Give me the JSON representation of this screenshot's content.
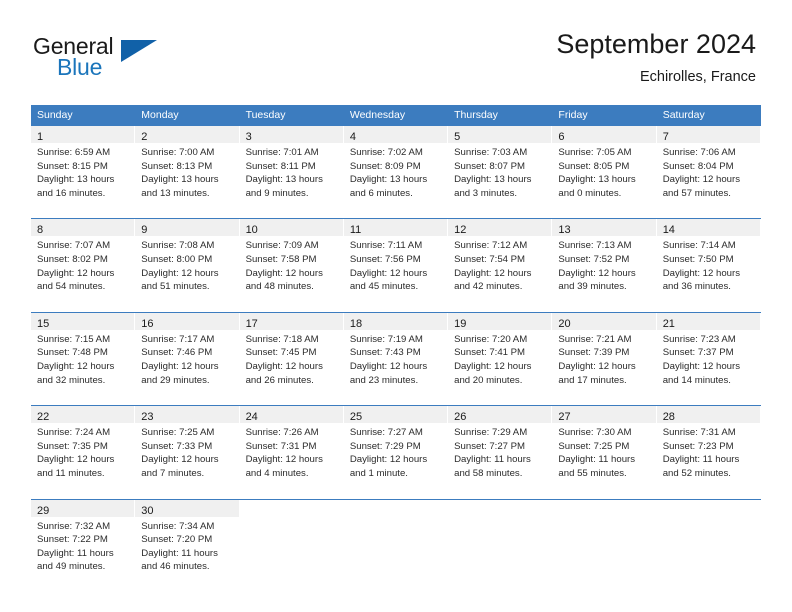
{
  "brand": {
    "word_one": "General",
    "word_two": "Blue",
    "flag_icon": "blue-triangle-flag-icon"
  },
  "header": {
    "title": "September 2024",
    "subtitle": "Echirolles, France"
  },
  "colors": {
    "header_blue": "#3c7cbf",
    "brand_blue": "#1b75bb",
    "flag_blue": "#1161a8",
    "day_band_gray": "#f0f0f0",
    "text": "#1a1a1a"
  },
  "weekdays": [
    "Sunday",
    "Monday",
    "Tuesday",
    "Wednesday",
    "Thursday",
    "Friday",
    "Saturday"
  ],
  "weeks": [
    [
      {
        "day": "1",
        "sunrise": "Sunrise: 6:59 AM",
        "sunset": "Sunset: 8:15 PM",
        "daylight_1": "Daylight: 13 hours",
        "daylight_2": "and 16 minutes."
      },
      {
        "day": "2",
        "sunrise": "Sunrise: 7:00 AM",
        "sunset": "Sunset: 8:13 PM",
        "daylight_1": "Daylight: 13 hours",
        "daylight_2": "and 13 minutes."
      },
      {
        "day": "3",
        "sunrise": "Sunrise: 7:01 AM",
        "sunset": "Sunset: 8:11 PM",
        "daylight_1": "Daylight: 13 hours",
        "daylight_2": "and 9 minutes."
      },
      {
        "day": "4",
        "sunrise": "Sunrise: 7:02 AM",
        "sunset": "Sunset: 8:09 PM",
        "daylight_1": "Daylight: 13 hours",
        "daylight_2": "and 6 minutes."
      },
      {
        "day": "5",
        "sunrise": "Sunrise: 7:03 AM",
        "sunset": "Sunset: 8:07 PM",
        "daylight_1": "Daylight: 13 hours",
        "daylight_2": "and 3 minutes."
      },
      {
        "day": "6",
        "sunrise": "Sunrise: 7:05 AM",
        "sunset": "Sunset: 8:05 PM",
        "daylight_1": "Daylight: 13 hours",
        "daylight_2": "and 0 minutes."
      },
      {
        "day": "7",
        "sunrise": "Sunrise: 7:06 AM",
        "sunset": "Sunset: 8:04 PM",
        "daylight_1": "Daylight: 12 hours",
        "daylight_2": "and 57 minutes."
      }
    ],
    [
      {
        "day": "8",
        "sunrise": "Sunrise: 7:07 AM",
        "sunset": "Sunset: 8:02 PM",
        "daylight_1": "Daylight: 12 hours",
        "daylight_2": "and 54 minutes."
      },
      {
        "day": "9",
        "sunrise": "Sunrise: 7:08 AM",
        "sunset": "Sunset: 8:00 PM",
        "daylight_1": "Daylight: 12 hours",
        "daylight_2": "and 51 minutes."
      },
      {
        "day": "10",
        "sunrise": "Sunrise: 7:09 AM",
        "sunset": "Sunset: 7:58 PM",
        "daylight_1": "Daylight: 12 hours",
        "daylight_2": "and 48 minutes."
      },
      {
        "day": "11",
        "sunrise": "Sunrise: 7:11 AM",
        "sunset": "Sunset: 7:56 PM",
        "daylight_1": "Daylight: 12 hours",
        "daylight_2": "and 45 minutes."
      },
      {
        "day": "12",
        "sunrise": "Sunrise: 7:12 AM",
        "sunset": "Sunset: 7:54 PM",
        "daylight_1": "Daylight: 12 hours",
        "daylight_2": "and 42 minutes."
      },
      {
        "day": "13",
        "sunrise": "Sunrise: 7:13 AM",
        "sunset": "Sunset: 7:52 PM",
        "daylight_1": "Daylight: 12 hours",
        "daylight_2": "and 39 minutes."
      },
      {
        "day": "14",
        "sunrise": "Sunrise: 7:14 AM",
        "sunset": "Sunset: 7:50 PM",
        "daylight_1": "Daylight: 12 hours",
        "daylight_2": "and 36 minutes."
      }
    ],
    [
      {
        "day": "15",
        "sunrise": "Sunrise: 7:15 AM",
        "sunset": "Sunset: 7:48 PM",
        "daylight_1": "Daylight: 12 hours",
        "daylight_2": "and 32 minutes."
      },
      {
        "day": "16",
        "sunrise": "Sunrise: 7:17 AM",
        "sunset": "Sunset: 7:46 PM",
        "daylight_1": "Daylight: 12 hours",
        "daylight_2": "and 29 minutes."
      },
      {
        "day": "17",
        "sunrise": "Sunrise: 7:18 AM",
        "sunset": "Sunset: 7:45 PM",
        "daylight_1": "Daylight: 12 hours",
        "daylight_2": "and 26 minutes."
      },
      {
        "day": "18",
        "sunrise": "Sunrise: 7:19 AM",
        "sunset": "Sunset: 7:43 PM",
        "daylight_1": "Daylight: 12 hours",
        "daylight_2": "and 23 minutes."
      },
      {
        "day": "19",
        "sunrise": "Sunrise: 7:20 AM",
        "sunset": "Sunset: 7:41 PM",
        "daylight_1": "Daylight: 12 hours",
        "daylight_2": "and 20 minutes."
      },
      {
        "day": "20",
        "sunrise": "Sunrise: 7:21 AM",
        "sunset": "Sunset: 7:39 PM",
        "daylight_1": "Daylight: 12 hours",
        "daylight_2": "and 17 minutes."
      },
      {
        "day": "21",
        "sunrise": "Sunrise: 7:23 AM",
        "sunset": "Sunset: 7:37 PM",
        "daylight_1": "Daylight: 12 hours",
        "daylight_2": "and 14 minutes."
      }
    ],
    [
      {
        "day": "22",
        "sunrise": "Sunrise: 7:24 AM",
        "sunset": "Sunset: 7:35 PM",
        "daylight_1": "Daylight: 12 hours",
        "daylight_2": "and 11 minutes."
      },
      {
        "day": "23",
        "sunrise": "Sunrise: 7:25 AM",
        "sunset": "Sunset: 7:33 PM",
        "daylight_1": "Daylight: 12 hours",
        "daylight_2": "and 7 minutes."
      },
      {
        "day": "24",
        "sunrise": "Sunrise: 7:26 AM",
        "sunset": "Sunset: 7:31 PM",
        "daylight_1": "Daylight: 12 hours",
        "daylight_2": "and 4 minutes."
      },
      {
        "day": "25",
        "sunrise": "Sunrise: 7:27 AM",
        "sunset": "Sunset: 7:29 PM",
        "daylight_1": "Daylight: 12 hours",
        "daylight_2": "and 1 minute."
      },
      {
        "day": "26",
        "sunrise": "Sunrise: 7:29 AM",
        "sunset": "Sunset: 7:27 PM",
        "daylight_1": "Daylight: 11 hours",
        "daylight_2": "and 58 minutes."
      },
      {
        "day": "27",
        "sunrise": "Sunrise: 7:30 AM",
        "sunset": "Sunset: 7:25 PM",
        "daylight_1": "Daylight: 11 hours",
        "daylight_2": "and 55 minutes."
      },
      {
        "day": "28",
        "sunrise": "Sunrise: 7:31 AM",
        "sunset": "Sunset: 7:23 PM",
        "daylight_1": "Daylight: 11 hours",
        "daylight_2": "and 52 minutes."
      }
    ],
    [
      {
        "day": "29",
        "sunrise": "Sunrise: 7:32 AM",
        "sunset": "Sunset: 7:22 PM",
        "daylight_1": "Daylight: 11 hours",
        "daylight_2": "and 49 minutes."
      },
      {
        "day": "30",
        "sunrise": "Sunrise: 7:34 AM",
        "sunset": "Sunset: 7:20 PM",
        "daylight_1": "Daylight: 11 hours",
        "daylight_2": "and 46 minutes."
      },
      {
        "day": "",
        "sunrise": "",
        "sunset": "",
        "daylight_1": "",
        "daylight_2": ""
      },
      {
        "day": "",
        "sunrise": "",
        "sunset": "",
        "daylight_1": "",
        "daylight_2": ""
      },
      {
        "day": "",
        "sunrise": "",
        "sunset": "",
        "daylight_1": "",
        "daylight_2": ""
      },
      {
        "day": "",
        "sunrise": "",
        "sunset": "",
        "daylight_1": "",
        "daylight_2": ""
      },
      {
        "day": "",
        "sunrise": "",
        "sunset": "",
        "daylight_1": "",
        "daylight_2": ""
      }
    ]
  ]
}
